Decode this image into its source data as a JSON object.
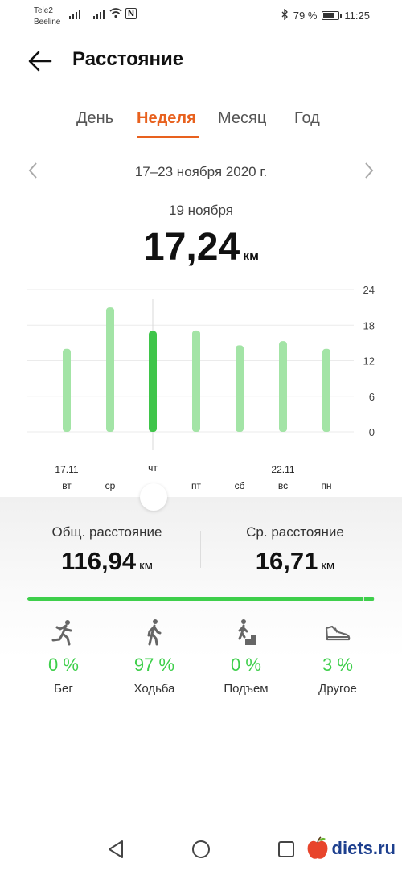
{
  "status_bar": {
    "carrier1": "Tele2",
    "carrier2": "Beeline",
    "battery_text": "79 %",
    "battery_level": 0.79,
    "time": "11:25"
  },
  "header": {
    "title": "Расстояние"
  },
  "tabs": [
    {
      "label": "День",
      "active": false
    },
    {
      "label": "Неделя",
      "active": true
    },
    {
      "label": "Месяц",
      "active": false
    },
    {
      "label": "Год",
      "active": false
    }
  ],
  "period": {
    "label": "17–23 ноября 2020 г."
  },
  "selected": {
    "date": "19 ноября",
    "value": "17,24",
    "unit": "км"
  },
  "chart_data": {
    "type": "bar",
    "categories": [
      "вт",
      "ср",
      "чт",
      "пт",
      "сб",
      "вс",
      "пн"
    ],
    "date_labels": [
      "17.11",
      "",
      "",
      "",
      "",
      "22.11",
      ""
    ],
    "values": [
      14.0,
      21.0,
      17.0,
      17.1,
      14.6,
      15.3,
      14.0
    ],
    "selected_index": 2,
    "y_ticks": [
      "24",
      "18",
      "12",
      "6",
      "0"
    ],
    "ylim": [
      0,
      24
    ],
    "grid": true,
    "colors": {
      "bar": "#a3e4a6",
      "selected": "#3fc54a"
    }
  },
  "summary": {
    "total_label": "Общ. расстояние",
    "total_value": "116,94",
    "avg_label": "Ср. расстояние",
    "avg_value": "16,71",
    "unit": "км"
  },
  "activity": [
    {
      "icon": "running-icon",
      "percent": "0 %",
      "label": "Бег",
      "share": 0
    },
    {
      "icon": "walking-icon",
      "percent": "97 %",
      "label": "Ходьба",
      "share": 0.97
    },
    {
      "icon": "climbing-icon",
      "percent": "0 %",
      "label": "Подъем",
      "share": 0
    },
    {
      "icon": "sneaker-icon",
      "percent": "3 %",
      "label": "Другое",
      "share": 0.03
    }
  ],
  "watermark": {
    "text": "diets.ru"
  },
  "colors": {
    "accent": "#e8611e",
    "green": "#3ecf4b"
  }
}
